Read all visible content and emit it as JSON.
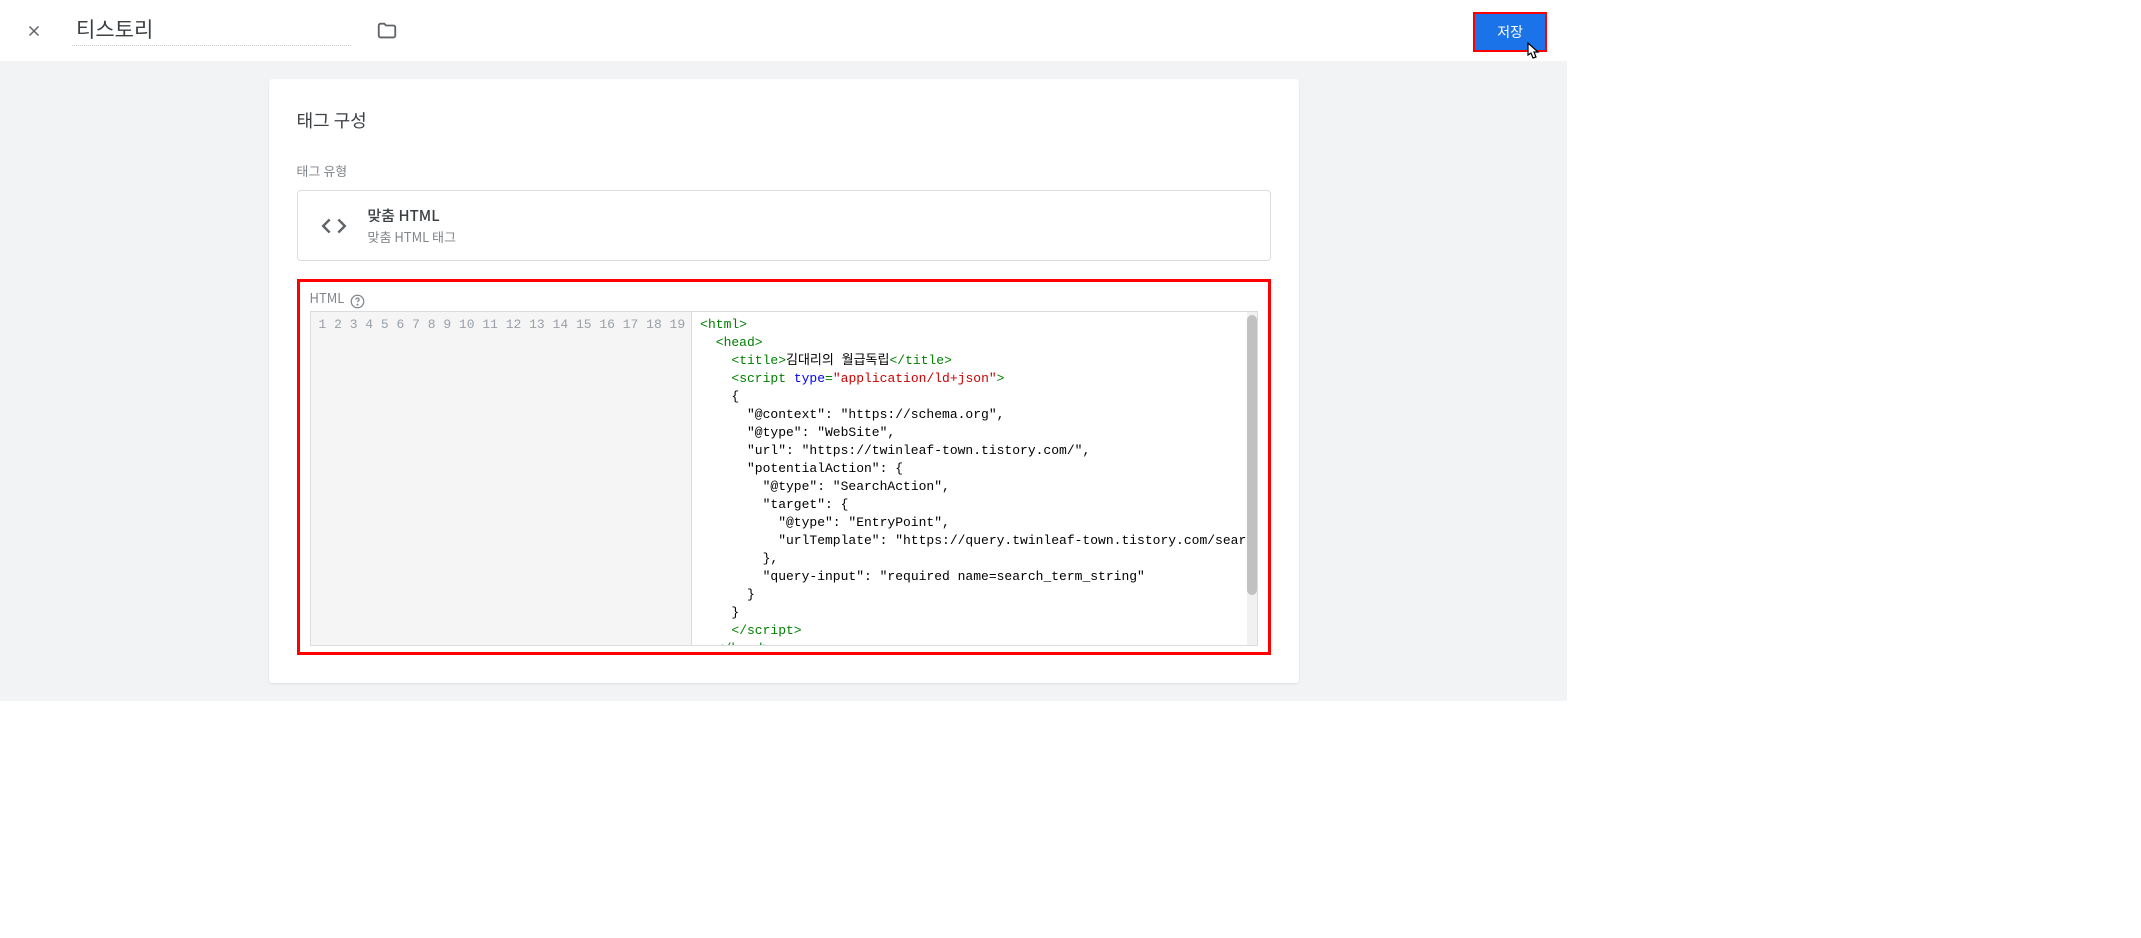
{
  "header": {
    "title_value": "티스토리",
    "save_label": "저장"
  },
  "section": {
    "config_title": "태그 구성",
    "tag_type_label": "태그 유형",
    "tag_type_name": "맞춤 HTML",
    "tag_type_desc": "맞춤 HTML 태그",
    "html_label": "HTML"
  },
  "editor": {
    "line_count": 19,
    "lines": [
      {
        "indent": 0,
        "type": "open",
        "tag": "html"
      },
      {
        "indent": 1,
        "type": "open",
        "tag": "head"
      },
      {
        "indent": 2,
        "type": "titletag",
        "open": "title",
        "text": "김대리의 월급독립",
        "close": "title"
      },
      {
        "indent": 2,
        "type": "script_open",
        "tag": "script",
        "attr": "type",
        "val": "application/ld+json"
      },
      {
        "indent": 2,
        "type": "text",
        "text": "{"
      },
      {
        "indent": 3,
        "type": "text",
        "text": "\"@context\": \"https://schema.org\","
      },
      {
        "indent": 3,
        "type": "text",
        "text": "\"@type\": \"WebSite\","
      },
      {
        "indent": 3,
        "type": "text",
        "text": "\"url\": \"https://twinleaf-town.tistory.com/\","
      },
      {
        "indent": 3,
        "type": "text",
        "text": "\"potentialAction\": {"
      },
      {
        "indent": 4,
        "type": "text",
        "text": "\"@type\": \"SearchAction\","
      },
      {
        "indent": 4,
        "type": "text",
        "text": "\"target\": {"
      },
      {
        "indent": 5,
        "type": "text",
        "text": "\"@type\": \"EntryPoint\","
      },
      {
        "indent": 5,
        "type": "text",
        "text": "\"urlTemplate\": \"https://query.twinleaf-town.tistory.com/search?q={search_term_string}\""
      },
      {
        "indent": 4,
        "type": "text",
        "text": "},"
      },
      {
        "indent": 4,
        "type": "text",
        "text": "\"query-input\": \"required name=search_term_string\""
      },
      {
        "indent": 3,
        "type": "text",
        "text": "}"
      },
      {
        "indent": 2,
        "type": "text",
        "text": "}"
      },
      {
        "indent": 2,
        "type": "close",
        "tag": "script"
      },
      {
        "indent": 1,
        "type": "close_partial",
        "tag": "head"
      }
    ]
  }
}
